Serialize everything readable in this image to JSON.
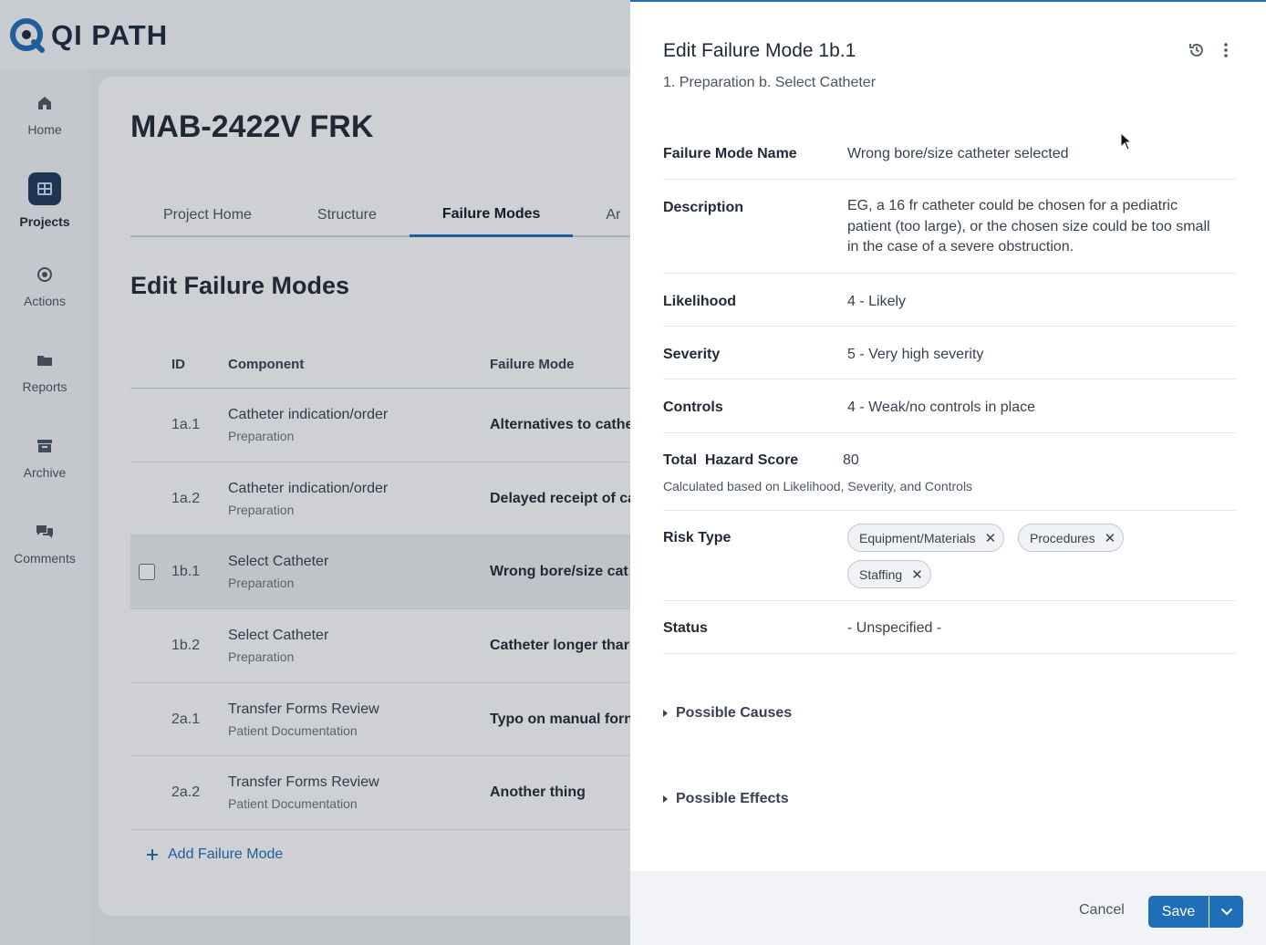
{
  "app": {
    "logo_text": "QI PATH"
  },
  "sidebar": {
    "items": [
      {
        "label": "Home",
        "icon": "home-icon"
      },
      {
        "label": "Projects",
        "icon": "grid-icon",
        "active": true
      },
      {
        "label": "Actions",
        "icon": "target-icon"
      },
      {
        "label": "Reports",
        "icon": "folder-icon"
      },
      {
        "label": "Archive",
        "icon": "archive-icon"
      },
      {
        "label": "Comments",
        "icon": "chat-icon"
      }
    ]
  },
  "project": {
    "title": "MAB-2422V FRK",
    "tabs": [
      "Project Home",
      "Structure",
      "Failure Modes",
      "Ar"
    ],
    "active_tab": "Failure Modes",
    "section_title": "Edit Failure Modes",
    "table": {
      "headers": {
        "id": "ID",
        "component": "Component",
        "failure_mode": "Failure Mode"
      },
      "rows": [
        {
          "id": "1a.1",
          "component": "Catheter indication/order",
          "step": "Preparation",
          "failure_mode": "Alternatives to cathe"
        },
        {
          "id": "1a.2",
          "component": "Catheter indication/order",
          "step": "Preparation",
          "failure_mode": "Delayed receipt of ca"
        },
        {
          "id": "1b.1",
          "component": "Select Catheter",
          "step": "Preparation",
          "failure_mode": "Wrong bore/size cat"
        },
        {
          "id": "1b.2",
          "component": "Select Catheter",
          "step": "Preparation",
          "failure_mode": "Catheter longer thar"
        },
        {
          "id": "2a.1",
          "component": "Transfer Forms Review",
          "step": "Patient Documentation",
          "failure_mode": "Typo on manual forn"
        },
        {
          "id": "2a.2",
          "component": "Transfer Forms Review",
          "step": "Patient Documentation",
          "failure_mode": "Another thing"
        }
      ]
    },
    "add_label": "Add Failure Mode"
  },
  "drawer": {
    "title": "Edit Failure Mode 1b.1",
    "subtitle": "1. Preparation b. Select Catheter",
    "fields": {
      "name": {
        "label": "Failure Mode Name",
        "value": "Wrong bore/size catheter selected"
      },
      "description": {
        "label": "Description",
        "value": "EG, a 16 fr catheter could be chosen for a pediatric patient (too large), or the chosen size could be too small in the case of a severe obstruction."
      },
      "likelihood": {
        "label": "Likelihood",
        "value": "4 - Likely"
      },
      "severity": {
        "label": "Severity",
        "value": "5 - Very high severity"
      },
      "controls": {
        "label": "Controls",
        "value": "4 - Weak/no controls in place"
      },
      "hazard": {
        "label": "Total  Hazard Score",
        "value": "80",
        "note": "Calculated based on Likelihood, Severity, and Controls"
      },
      "risk_type": {
        "label": "Risk Type",
        "chips": [
          "Equipment/Materials",
          "Procedures",
          "Staffing"
        ]
      },
      "status": {
        "label": "Status",
        "value": "- Unspecified -"
      }
    },
    "possible_causes": "Possible Causes",
    "possible_effects": "Possible Effects",
    "footer": {
      "cancel": "Cancel",
      "save": "Save"
    }
  },
  "colors": {
    "primary": "#1e6fb8",
    "nav_active": "#1e3a5f"
  }
}
